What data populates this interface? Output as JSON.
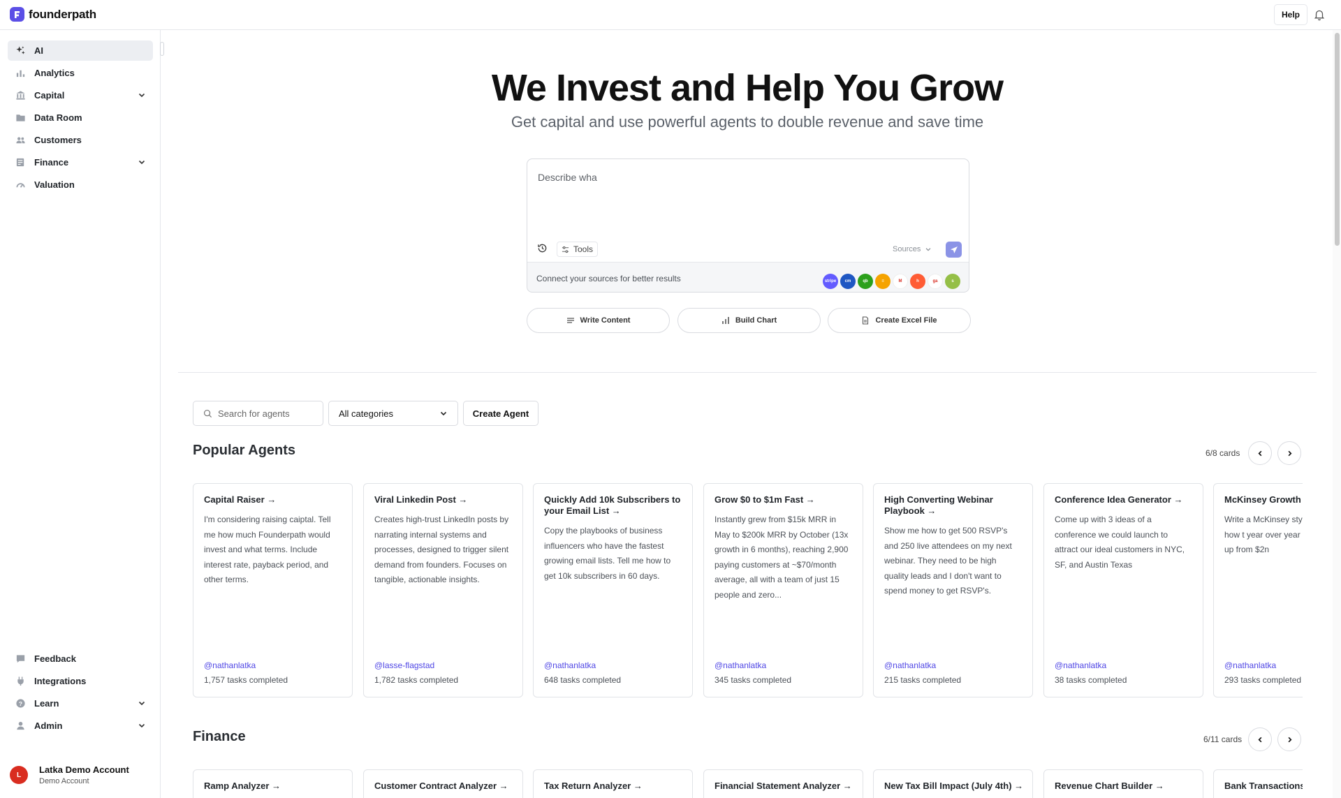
{
  "app": {
    "name": "founderpath"
  },
  "topbar": {
    "help_label": "Help"
  },
  "sidebar": {
    "items": [
      {
        "label": "AI",
        "icon": "sparkle-icon",
        "active": true
      },
      {
        "label": "Analytics",
        "icon": "bar-chart-icon"
      },
      {
        "label": "Capital",
        "icon": "bank-icon",
        "expandable": true
      },
      {
        "label": "Data Room",
        "icon": "folder-icon"
      },
      {
        "label": "Customers",
        "icon": "users-icon"
      },
      {
        "label": "Finance",
        "icon": "ledger-icon",
        "expandable": true
      },
      {
        "label": "Valuation",
        "icon": "gauge-icon"
      }
    ],
    "bottom_items": [
      {
        "label": "Feedback",
        "icon": "message-icon"
      },
      {
        "label": "Integrations",
        "icon": "plug-icon"
      },
      {
        "label": "Learn",
        "icon": "question-icon",
        "expandable": true
      },
      {
        "label": "Admin",
        "icon": "user-icon",
        "expandable": true
      }
    ],
    "account": {
      "initial": "L",
      "name": "Latka Demo Account",
      "sub": "Demo Account"
    }
  },
  "hero": {
    "title": "We Invest and Help You Grow",
    "subtitle": "Get capital and use powerful agents to double revenue and save time"
  },
  "prompt": {
    "value": "Describe wha",
    "tools_label": "Tools",
    "sources_label": "Sources",
    "connect_text": "Connect your sources for better results",
    "source_icons": [
      {
        "name": "stripe-icon",
        "text": "stripe",
        "color": "#635bff"
      },
      {
        "name": "chartmogul-icon",
        "text": "cm",
        "color": "#1f57c3"
      },
      {
        "name": "quickbooks-icon",
        "text": "qb",
        "color": "#2ca01c"
      },
      {
        "name": "baremetrics-icon",
        "text": "≡",
        "color": "#f5a300"
      },
      {
        "name": "gmail-icon",
        "text": "M",
        "color": "#ffffff"
      },
      {
        "name": "hubspot-icon",
        "text": "h",
        "color": "#ff5c35"
      },
      {
        "name": "google-analytics-icon",
        "text": "ga",
        "color": "#ffffff"
      },
      {
        "name": "shopify-icon",
        "text": "s",
        "color": "#95bf47"
      }
    ]
  },
  "quick_actions": [
    {
      "label": "Write Content",
      "icon": "lines-icon"
    },
    {
      "label": "Build Chart",
      "icon": "chart-icon"
    },
    {
      "label": "Create Excel File",
      "icon": "file-icon"
    }
  ],
  "filters": {
    "search_placeholder": "Search for agents",
    "category_value": "All categories",
    "create_label": "Create Agent"
  },
  "popular": {
    "title": "Popular Agents",
    "count": "6/8 cards",
    "cards": [
      {
        "title": "Capital Raiser →",
        "desc": "I'm considering raising caiptal. Tell me how much Founderpath would invest and what terms. Include interest rate, payback period, and other terms.",
        "author": "@nathanlatka",
        "tasks": "1,757 tasks completed"
      },
      {
        "title": "Viral Linkedin Post →",
        "desc": "Creates high-trust LinkedIn posts by narrating internal systems and processes, designed to trigger silent demand from founders. Focuses on tangible, actionable insights.",
        "author": "@lasse-flagstad",
        "tasks": "1,782 tasks completed"
      },
      {
        "title": "Quickly Add 10k Subscribers to your Email List →",
        "desc": "Copy the playbooks of business influencers who have the fastest growing email lists. Tell me how to get 10k subscribers in 60 days.",
        "author": "@nathanlatka",
        "tasks": "648 tasks completed"
      },
      {
        "title": "Grow $0 to $1m Fast →",
        "desc": "Instantly grew from $15k MRR in May to $200k MRR by October (13x growth in 6 months), reaching 2,900 paying customers at ~$70/month average, all with a team of just 15 people and zero...",
        "author": "@nathanlatka",
        "tasks": "345 tasks completed"
      },
      {
        "title": "High Converting Webinar Playbook →",
        "desc": "Show me how to get 500 RSVP's and 250 live attendees on my next webinar. They need to be high quality leads and I don't want to spend money to get RSVP's.",
        "author": "@nathanlatka",
        "tasks": "215 tasks completed"
      },
      {
        "title": "Conference Idea Generator →",
        "desc": "Come up with 3 ideas of a conference we could launch to attract our ideal customers in NYC, SF, and Austin Texas",
        "author": "@nathanlatka",
        "tasks": "38 tasks completed"
      },
      {
        "title": "McKinsey Growth F",
        "desc": "Write a McKinsey sty that shows me how t year over year and b revenue up from $2n",
        "author": "@nathanlatka",
        "tasks": "293 tasks completed"
      }
    ]
  },
  "finance": {
    "title": "Finance",
    "count": "6/11 cards",
    "cards": [
      {
        "title": "Ramp Analyzer →"
      },
      {
        "title": "Customer Contract Analyzer →"
      },
      {
        "title": "Tax Return Analyzer →"
      },
      {
        "title": "Financial Statement Analyzer →"
      },
      {
        "title": "New Tax Bill Impact (July 4th) →"
      },
      {
        "title": "Revenue Chart Builder →"
      },
      {
        "title": "Bank Transactions"
      }
    ]
  }
}
